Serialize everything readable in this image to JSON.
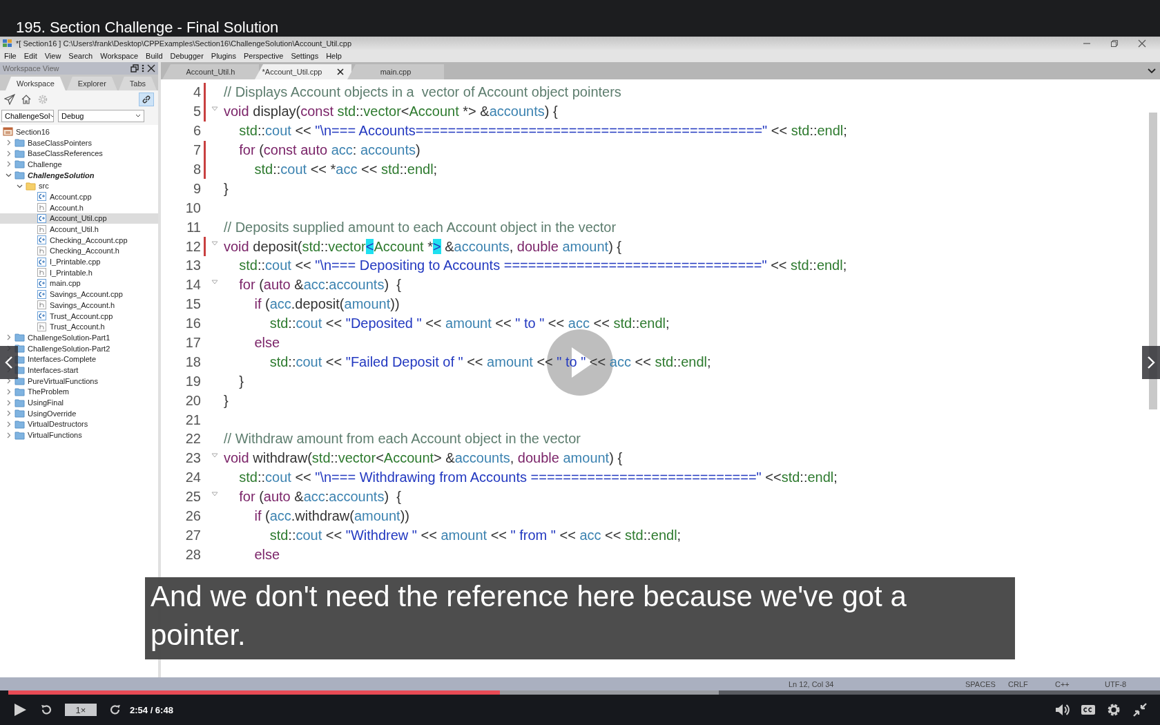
{
  "video_title": "195. Section Challenge - Final Solution",
  "ide": {
    "window_title": "*[ Section16 ] C:\\Users\\frank\\Desktop\\CPPExamples\\Section16\\ChallengeSolution\\Account_Util.cpp",
    "menu": [
      "File",
      "Edit",
      "View",
      "Search",
      "Workspace",
      "Build",
      "Debugger",
      "Plugins",
      "Perspective",
      "Settings",
      "Help"
    ],
    "sidebar": {
      "title": "Workspace View",
      "tabs": [
        {
          "label": "Workspace",
          "selected": true
        },
        {
          "label": "Explorer",
          "selected": false
        },
        {
          "label": "Tabs",
          "selected": false
        }
      ],
      "link_with_editor": true,
      "project_select": "ChallengeSol",
      "config_select": "Debug",
      "tree": [
        {
          "kind": "workspace",
          "label": "Section16",
          "selected": false,
          "children": [
            {
              "kind": "folder",
              "label": "BaseClassPointers",
              "expanded": false,
              "active": false,
              "selected": false
            },
            {
              "kind": "folder",
              "label": "BaseClassReferences",
              "expanded": false,
              "active": false,
              "selected": false
            },
            {
              "kind": "folder",
              "label": "Challenge",
              "expanded": false,
              "active": false,
              "selected": false
            },
            {
              "kind": "folder",
              "label": "ChallengeSolution",
              "expanded": true,
              "active": true,
              "selected": false,
              "children": [
                {
                  "kind": "src",
                  "label": "src",
                  "expanded": true,
                  "active": false,
                  "selected": false,
                  "children": [
                    {
                      "kind": "cpp",
                      "label": "Account.cpp",
                      "selected": false
                    },
                    {
                      "kind": "h",
                      "label": "Account.h",
                      "selected": false
                    },
                    {
                      "kind": "cpp",
                      "label": "Account_Util.cpp",
                      "selected": true
                    },
                    {
                      "kind": "h",
                      "label": "Account_Util.h",
                      "selected": false
                    },
                    {
                      "kind": "cpp",
                      "label": "Checking_Account.cpp",
                      "selected": false
                    },
                    {
                      "kind": "h",
                      "label": "Checking_Account.h",
                      "selected": false
                    },
                    {
                      "kind": "cpp",
                      "label": "I_Printable.cpp",
                      "selected": false
                    },
                    {
                      "kind": "h",
                      "label": "I_Printable.h",
                      "selected": false
                    },
                    {
                      "kind": "cpp",
                      "label": "main.cpp",
                      "selected": false
                    },
                    {
                      "kind": "cpp",
                      "label": "Savings_Account.cpp",
                      "selected": false
                    },
                    {
                      "kind": "h",
                      "label": "Savings_Account.h",
                      "selected": false
                    },
                    {
                      "kind": "cpp",
                      "label": "Trust_Account.cpp",
                      "selected": false
                    },
                    {
                      "kind": "h",
                      "label": "Trust_Account.h",
                      "selected": false
                    }
                  ]
                }
              ]
            },
            {
              "kind": "folder",
              "label": "ChallengeSolution-Part1",
              "expanded": false,
              "active": false,
              "selected": false
            },
            {
              "kind": "folder",
              "label": "ChallengeSolution-Part2",
              "expanded": false,
              "active": false,
              "selected": false
            },
            {
              "kind": "folder",
              "label": "Interfaces-Complete",
              "expanded": false,
              "active": false,
              "selected": false
            },
            {
              "kind": "folder",
              "label": "Interfaces-start",
              "expanded": false,
              "active": false,
              "selected": false
            },
            {
              "kind": "folder",
              "label": "PureVirtualFunctions",
              "expanded": false,
              "active": false,
              "selected": false
            },
            {
              "kind": "folder",
              "label": "TheProblem",
              "expanded": false,
              "active": false,
              "selected": false
            },
            {
              "kind": "folder",
              "label": "UsingFinal",
              "expanded": false,
              "active": false,
              "selected": false
            },
            {
              "kind": "folder",
              "label": "UsingOverride",
              "expanded": false,
              "active": false,
              "selected": false
            },
            {
              "kind": "folder",
              "label": "VirtualDestructors",
              "expanded": false,
              "active": false,
              "selected": false
            },
            {
              "kind": "folder",
              "label": "VirtualFunctions",
              "expanded": false,
              "active": false,
              "selected": false
            }
          ]
        }
      ]
    },
    "editor_tabs": [
      {
        "label": "Account_Util.h",
        "selected": false
      },
      {
        "label": "*Account_Util.cpp",
        "selected": true
      },
      {
        "label": "main.cpp",
        "selected": false
      }
    ],
    "lines": [
      {
        "number": "4",
        "modified": true,
        "fold": false,
        "tokens": [
          {
            "kind": "comment",
            "text": "// Displays Account objects in a  vector of Account object pointers"
          }
        ]
      },
      {
        "number": "5",
        "modified": true,
        "fold": true,
        "tokens": [
          {
            "kind": "keyword",
            "text": "void"
          },
          {
            "kind": "plain",
            "text": " display("
          },
          {
            "kind": "keyword",
            "text": "const "
          },
          {
            "kind": "type",
            "text": "std"
          },
          {
            "kind": "plain",
            "text": "::"
          },
          {
            "kind": "type",
            "text": "vector"
          },
          {
            "kind": "plain",
            "text": "<"
          },
          {
            "kind": "type",
            "text": "Account"
          },
          {
            "kind": "plain",
            "text": " *> &"
          },
          {
            "kind": "ident",
            "text": "accounts"
          },
          {
            "kind": "plain",
            "text": ") {"
          }
        ]
      },
      {
        "number": "6",
        "modified": false,
        "fold": false,
        "tokens": [
          {
            "kind": "type",
            "text": "    std"
          },
          {
            "kind": "plain",
            "text": "::"
          },
          {
            "kind": "ident",
            "text": "cout"
          },
          {
            "kind": "plain",
            "text": " << "
          },
          {
            "kind": "string",
            "text": "\"\\n=== Accounts===========================================\""
          },
          {
            "kind": "plain",
            "text": " << "
          },
          {
            "kind": "type",
            "text": "std"
          },
          {
            "kind": "plain",
            "text": "::"
          },
          {
            "kind": "type",
            "text": "endl"
          },
          {
            "kind": "plain",
            "text": ";"
          }
        ]
      },
      {
        "number": "7",
        "modified": true,
        "fold": false,
        "tokens": [
          {
            "kind": "keyword",
            "text": "    for"
          },
          {
            "kind": "plain",
            "text": " ("
          },
          {
            "kind": "keyword",
            "text": "const "
          },
          {
            "kind": "keyword",
            "text": "auto "
          },
          {
            "kind": "ident",
            "text": "acc"
          },
          {
            "kind": "plain",
            "text": ": "
          },
          {
            "kind": "ident",
            "text": "accounts"
          },
          {
            "kind": "plain",
            "text": ")"
          }
        ]
      },
      {
        "number": "8",
        "modified": true,
        "fold": false,
        "tokens": [
          {
            "kind": "type",
            "text": "        std"
          },
          {
            "kind": "plain",
            "text": "::"
          },
          {
            "kind": "ident",
            "text": "cout"
          },
          {
            "kind": "plain",
            "text": " << *"
          },
          {
            "kind": "ident",
            "text": "acc"
          },
          {
            "kind": "plain",
            "text": " << "
          },
          {
            "kind": "type",
            "text": "std"
          },
          {
            "kind": "plain",
            "text": "::"
          },
          {
            "kind": "type",
            "text": "endl"
          },
          {
            "kind": "plain",
            "text": ";"
          }
        ]
      },
      {
        "number": "9",
        "modified": false,
        "fold": false,
        "tokens": [
          {
            "kind": "plain",
            "text": "}"
          }
        ]
      },
      {
        "number": "10",
        "modified": false,
        "fold": false
      },
      {
        "number": "11",
        "modified": false,
        "fold": false,
        "tokens": [
          {
            "kind": "comment",
            "text": "// Deposits supplied amount to each Account object in the vector"
          }
        ]
      },
      {
        "number": "12",
        "modified": true,
        "fold": true,
        "tokens": [
          {
            "kind": "keyword",
            "text": "void"
          },
          {
            "kind": "plain",
            "text": " deposit("
          },
          {
            "kind": "type",
            "text": "std"
          },
          {
            "kind": "plain",
            "text": "::"
          },
          {
            "kind": "type",
            "text": "vector"
          },
          {
            "kind": "match",
            "text": "<"
          },
          {
            "kind": "type",
            "text": "Account"
          },
          {
            "kind": "plain",
            "text": " *"
          },
          {
            "kind": "match",
            "text": ">"
          },
          {
            "kind": "plain",
            "text": " &"
          },
          {
            "kind": "ident",
            "text": "accounts"
          },
          {
            "kind": "plain",
            "text": ", "
          },
          {
            "kind": "keyword",
            "text": "double "
          },
          {
            "kind": "ident",
            "text": "amount"
          },
          {
            "kind": "plain",
            "text": ") {"
          }
        ]
      },
      {
        "number": "13",
        "modified": false,
        "fold": false,
        "tokens": [
          {
            "kind": "type",
            "text": "    std"
          },
          {
            "kind": "plain",
            "text": "::"
          },
          {
            "kind": "ident",
            "text": "cout"
          },
          {
            "kind": "plain",
            "text": " << "
          },
          {
            "kind": "string",
            "text": "\"\\n=== Depositing to Accounts ================================\""
          },
          {
            "kind": "plain",
            "text": " << "
          },
          {
            "kind": "type",
            "text": "std"
          },
          {
            "kind": "plain",
            "text": "::"
          },
          {
            "kind": "type",
            "text": "endl"
          },
          {
            "kind": "plain",
            "text": ";"
          }
        ]
      },
      {
        "number": "14",
        "modified": false,
        "fold": true,
        "tokens": [
          {
            "kind": "keyword",
            "text": "    for"
          },
          {
            "kind": "plain",
            "text": " ("
          },
          {
            "kind": "keyword",
            "text": "auto"
          },
          {
            "kind": "plain",
            "text": " &"
          },
          {
            "kind": "ident",
            "text": "acc"
          },
          {
            "kind": "plain",
            "text": ":"
          },
          {
            "kind": "ident",
            "text": "accounts"
          },
          {
            "kind": "plain",
            "text": ")  {"
          }
        ]
      },
      {
        "number": "15",
        "modified": false,
        "fold": false,
        "tokens": [
          {
            "kind": "keyword",
            "text": "        if"
          },
          {
            "kind": "plain",
            "text": " ("
          },
          {
            "kind": "ident",
            "text": "acc"
          },
          {
            "kind": "plain",
            "text": ".deposit("
          },
          {
            "kind": "ident",
            "text": "amount"
          },
          {
            "kind": "plain",
            "text": "))"
          }
        ]
      },
      {
        "number": "16",
        "modified": false,
        "fold": false,
        "tokens": [
          {
            "kind": "type",
            "text": "            std"
          },
          {
            "kind": "plain",
            "text": "::"
          },
          {
            "kind": "ident",
            "text": "cout"
          },
          {
            "kind": "plain",
            "text": " << "
          },
          {
            "kind": "string",
            "text": "\"Deposited \""
          },
          {
            "kind": "plain",
            "text": " << "
          },
          {
            "kind": "ident",
            "text": "amount"
          },
          {
            "kind": "plain",
            "text": " << "
          },
          {
            "kind": "string",
            "text": "\" to \""
          },
          {
            "kind": "plain",
            "text": " << "
          },
          {
            "kind": "ident",
            "text": "acc"
          },
          {
            "kind": "plain",
            "text": " << "
          },
          {
            "kind": "type",
            "text": "std"
          },
          {
            "kind": "plain",
            "text": "::"
          },
          {
            "kind": "type",
            "text": "endl"
          },
          {
            "kind": "plain",
            "text": ";"
          }
        ]
      },
      {
        "number": "17",
        "modified": false,
        "fold": false,
        "tokens": [
          {
            "kind": "keyword",
            "text": "        else"
          }
        ]
      },
      {
        "number": "18",
        "modified": false,
        "fold": false,
        "tokens": [
          {
            "kind": "type",
            "text": "            std"
          },
          {
            "kind": "plain",
            "text": "::"
          },
          {
            "kind": "ident",
            "text": "cout"
          },
          {
            "kind": "plain",
            "text": " << "
          },
          {
            "kind": "string",
            "text": "\"Failed Deposit of \""
          },
          {
            "kind": "plain",
            "text": " << "
          },
          {
            "kind": "ident",
            "text": "amount"
          },
          {
            "kind": "plain",
            "text": " << "
          },
          {
            "kind": "string",
            "text": "\" to \""
          },
          {
            "kind": "plain",
            "text": " << "
          },
          {
            "kind": "ident",
            "text": "acc"
          },
          {
            "kind": "plain",
            "text": " << "
          },
          {
            "kind": "type",
            "text": "std"
          },
          {
            "kind": "plain",
            "text": "::"
          },
          {
            "kind": "type",
            "text": "endl"
          },
          {
            "kind": "plain",
            "text": ";"
          }
        ]
      },
      {
        "number": "19",
        "modified": false,
        "fold": false,
        "tokens": [
          {
            "kind": "plain",
            "text": "    }"
          }
        ]
      },
      {
        "number": "20",
        "modified": false,
        "fold": false,
        "tokens": [
          {
            "kind": "plain",
            "text": "}"
          }
        ]
      },
      {
        "number": "21",
        "modified": false,
        "fold": false
      },
      {
        "number": "22",
        "modified": false,
        "fold": false,
        "tokens": [
          {
            "kind": "comment",
            "text": "// Withdraw amount from each Account object in the vector"
          }
        ]
      },
      {
        "number": "23",
        "modified": false,
        "fold": true,
        "tokens": [
          {
            "kind": "keyword",
            "text": "void"
          },
          {
            "kind": "plain",
            "text": " withdraw("
          },
          {
            "kind": "type",
            "text": "std"
          },
          {
            "kind": "plain",
            "text": "::"
          },
          {
            "kind": "type",
            "text": "vector"
          },
          {
            "kind": "plain",
            "text": "<"
          },
          {
            "kind": "type",
            "text": "Account"
          },
          {
            "kind": "plain",
            "text": "> &"
          },
          {
            "kind": "ident",
            "text": "accounts"
          },
          {
            "kind": "plain",
            "text": ", "
          },
          {
            "kind": "keyword",
            "text": "double "
          },
          {
            "kind": "ident",
            "text": "amount"
          },
          {
            "kind": "plain",
            "text": ") {"
          }
        ]
      },
      {
        "number": "24",
        "modified": false,
        "fold": false,
        "tokens": [
          {
            "kind": "type",
            "text": "    std"
          },
          {
            "kind": "plain",
            "text": "::"
          },
          {
            "kind": "ident",
            "text": "cout"
          },
          {
            "kind": "plain",
            "text": " << "
          },
          {
            "kind": "string",
            "text": "\"\\n=== Withdrawing from Accounts ============================\""
          },
          {
            "kind": "plain",
            "text": " <<"
          },
          {
            "kind": "type",
            "text": "std"
          },
          {
            "kind": "plain",
            "text": "::"
          },
          {
            "kind": "type",
            "text": "endl"
          },
          {
            "kind": "plain",
            "text": ";"
          }
        ]
      },
      {
        "number": "25",
        "modified": false,
        "fold": true,
        "tokens": [
          {
            "kind": "keyword",
            "text": "    for"
          },
          {
            "kind": "plain",
            "text": " ("
          },
          {
            "kind": "keyword",
            "text": "auto"
          },
          {
            "kind": "plain",
            "text": " &"
          },
          {
            "kind": "ident",
            "text": "acc"
          },
          {
            "kind": "plain",
            "text": ":"
          },
          {
            "kind": "ident",
            "text": "accounts"
          },
          {
            "kind": "plain",
            "text": ")  {"
          }
        ]
      },
      {
        "number": "26",
        "modified": false,
        "fold": false,
        "tokens": [
          {
            "kind": "keyword",
            "text": "        if"
          },
          {
            "kind": "plain",
            "text": " ("
          },
          {
            "kind": "ident",
            "text": "acc"
          },
          {
            "kind": "plain",
            "text": ".withdraw("
          },
          {
            "kind": "ident",
            "text": "amount"
          },
          {
            "kind": "plain",
            "text": "))"
          }
        ]
      },
      {
        "number": "27",
        "modified": false,
        "fold": false,
        "tokens": [
          {
            "kind": "type",
            "text": "            std"
          },
          {
            "kind": "plain",
            "text": "::"
          },
          {
            "kind": "ident",
            "text": "cout"
          },
          {
            "kind": "plain",
            "text": " << "
          },
          {
            "kind": "string",
            "text": "\"Withdrew \""
          },
          {
            "kind": "plain",
            "text": " << "
          },
          {
            "kind": "ident",
            "text": "amount"
          },
          {
            "kind": "plain",
            "text": " << "
          },
          {
            "kind": "string",
            "text": "\" from \""
          },
          {
            "kind": "plain",
            "text": " << "
          },
          {
            "kind": "ident",
            "text": "acc"
          },
          {
            "kind": "plain",
            "text": " << "
          },
          {
            "kind": "type",
            "text": "std"
          },
          {
            "kind": "plain",
            "text": "::"
          },
          {
            "kind": "type",
            "text": "endl"
          },
          {
            "kind": "plain",
            "text": ";"
          }
        ]
      },
      {
        "number": "28",
        "modified": false,
        "fold": false,
        "tokens": [
          {
            "kind": "keyword",
            "text": "        else"
          }
        ]
      }
    ],
    "status_bar": {
      "position": "Ln 12, Col 34",
      "indentation": "SPACES",
      "line_endings": "CRLF",
      "language": "C++",
      "encoding": "UTF-8"
    }
  },
  "player": {
    "subtitle": "And we don't need the reference here because we've got a pointer.",
    "paused": true,
    "progress": {
      "level": 0.427
    },
    "buffered": {
      "level": 0.617
    },
    "speed": "1×",
    "time": "2:54 / 6:48"
  }
}
